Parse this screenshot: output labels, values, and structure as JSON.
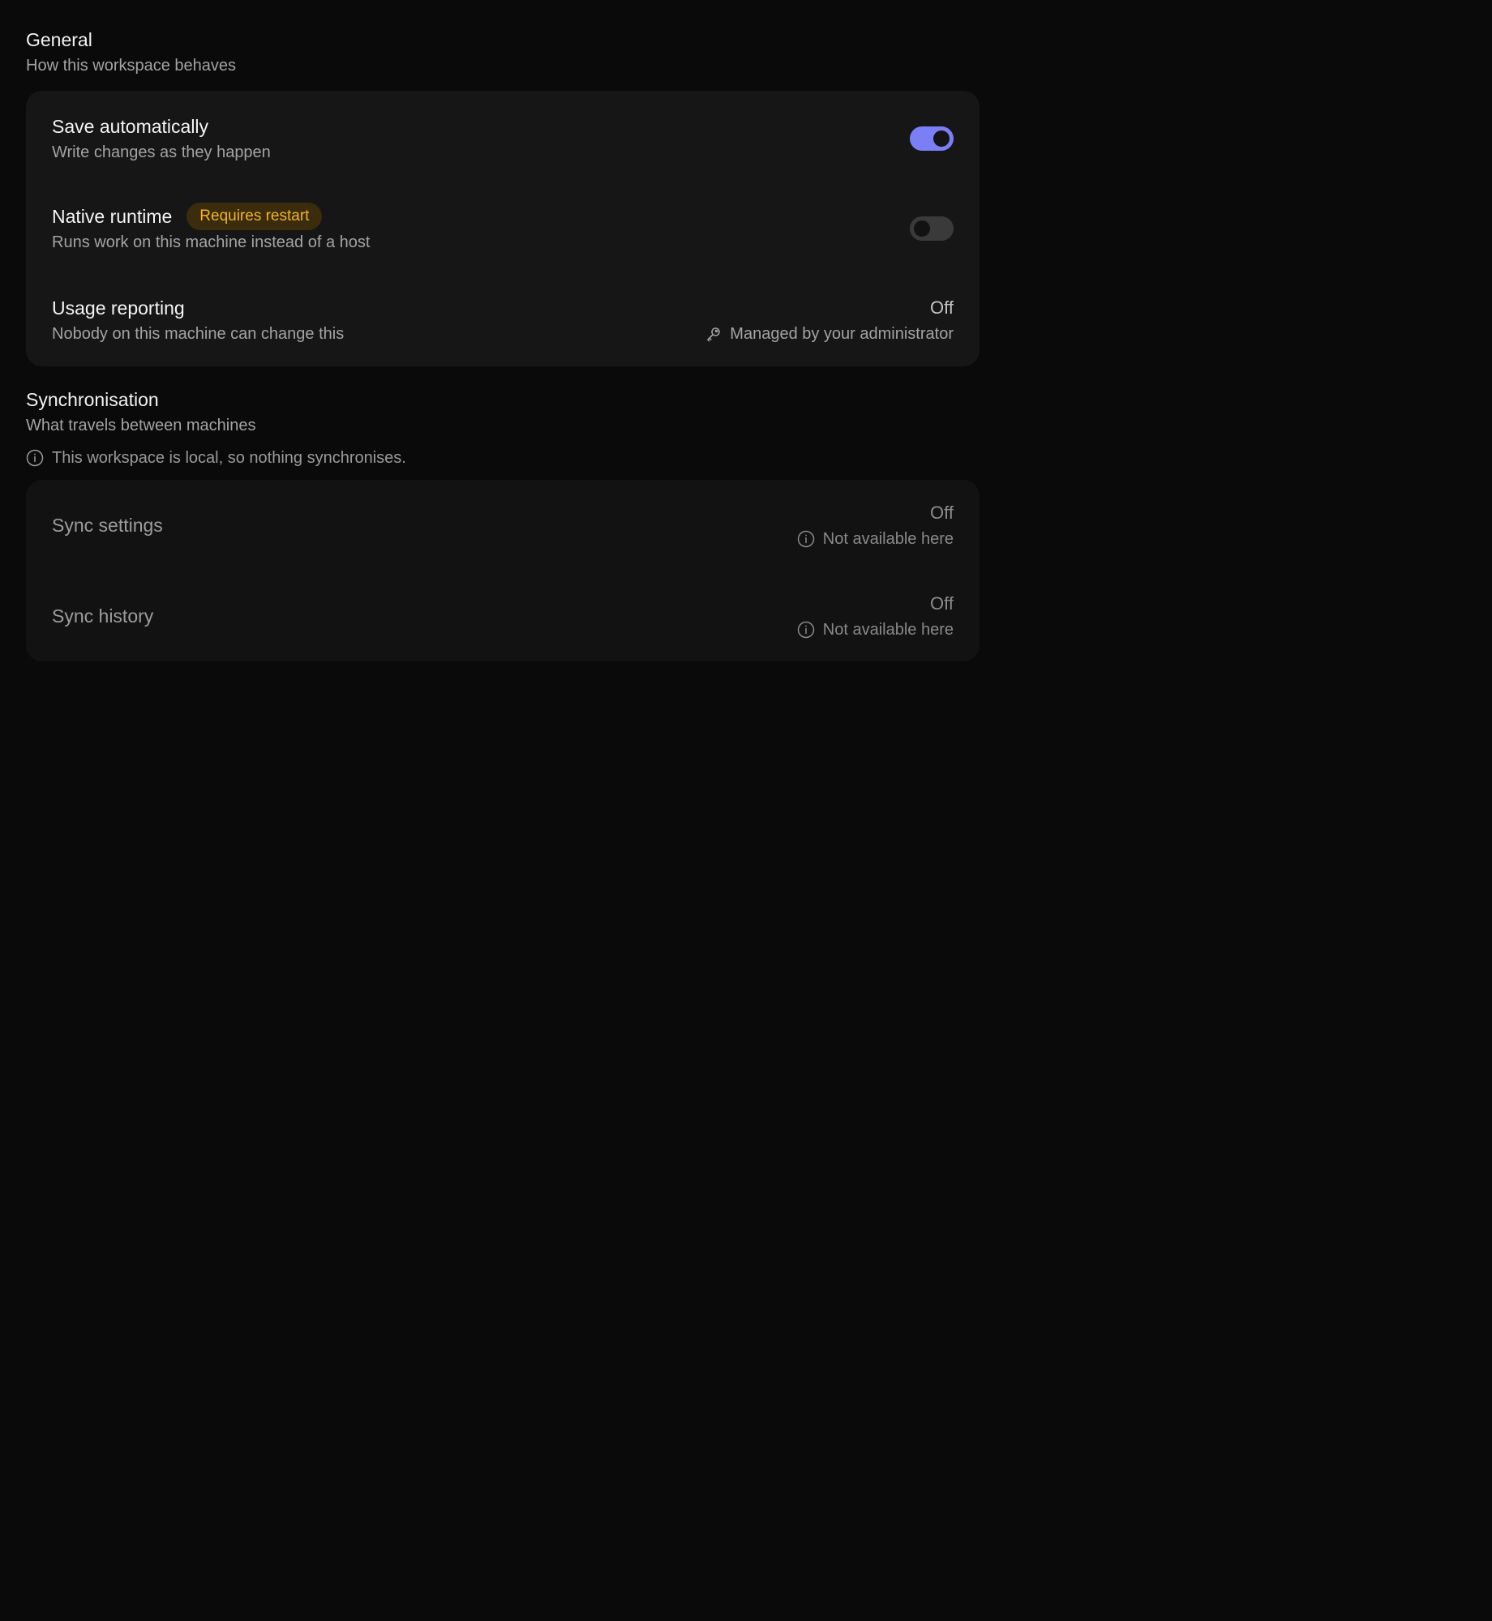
{
  "general": {
    "title": "General",
    "subtitle": "How this workspace behaves",
    "rows": [
      {
        "title": "Save automatically",
        "description": "Write changes as they happen",
        "toggle": "on"
      },
      {
        "title": "Native runtime",
        "badge": "Requires restart",
        "description": "Runs work on this machine instead of a host",
        "toggle": "off"
      },
      {
        "title": "Usage reporting",
        "description": "Nobody on this machine can change this",
        "value": "Off",
        "meta": "Managed by your administrator",
        "meta_icon": "key-icon"
      }
    ]
  },
  "sync": {
    "title": "Synchronisation",
    "subtitle": "What travels between machines",
    "notice": "This workspace is local, so nothing synchronises.",
    "notice_icon": "info-icon",
    "rows": [
      {
        "title": "Sync settings",
        "value": "Off",
        "meta": "Not available here",
        "meta_icon": "info-icon"
      },
      {
        "title": "Sync history",
        "value": "Off",
        "meta": "Not available here",
        "meta_icon": "info-icon"
      }
    ]
  },
  "colors": {
    "background": "#0a0a0a",
    "card": "#161616",
    "toggle_on": "#7b7ff5",
    "badge_text": "#f5b324",
    "badge_bg": "#3a2c0c"
  }
}
